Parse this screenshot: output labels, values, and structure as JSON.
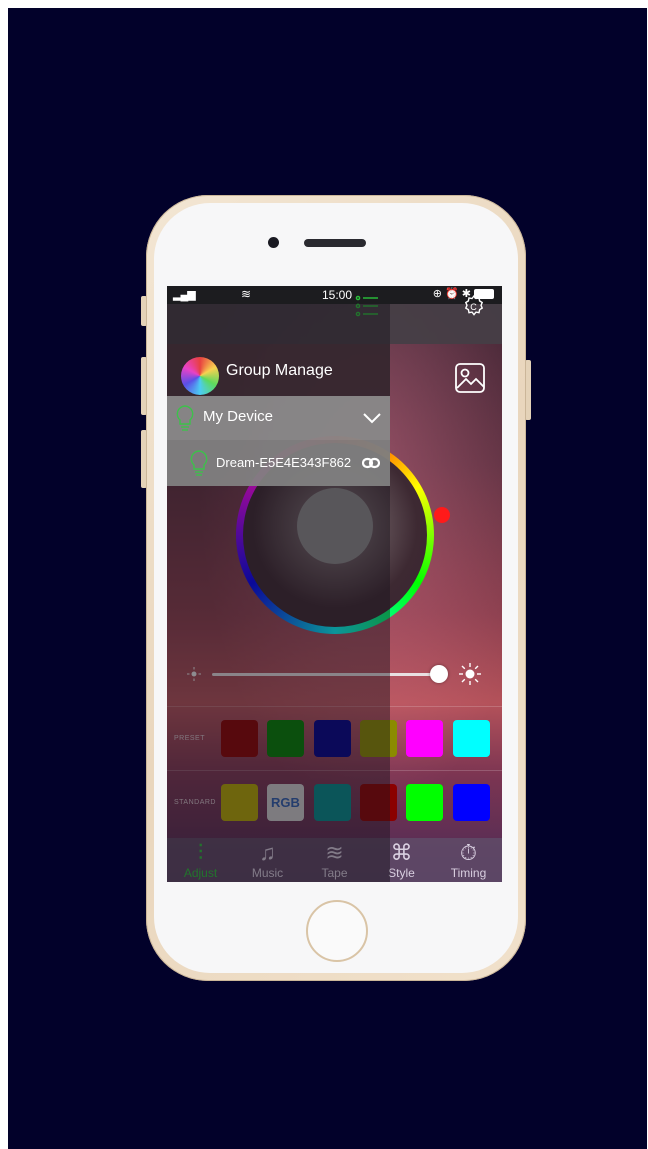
{
  "status_bar": {
    "signal": "▂▄▆",
    "wifi": "≋",
    "time": "15:00",
    "right_icons": "⊕ ⏰ ✱"
  },
  "header": {
    "list_icon": "list-icon",
    "settings_icon": "gear-icon",
    "gallery_icon": "image-icon"
  },
  "drawer": {
    "group_label": "Group Manage",
    "device_section_label": "My Device",
    "device_name": "Dream-E5E4E343F862"
  },
  "brightness": {
    "level": 0.95
  },
  "colors": {
    "wheel_knob": "#ff1a1a",
    "active_tab": "#2ac23a"
  },
  "preset": {
    "label": "PRESET",
    "swatches": [
      "#8b0000",
      "#008000",
      "#00008b",
      "#8b8b00",
      "#ff00ff",
      "#00ffff"
    ]
  },
  "standard": {
    "label": "STANDARD",
    "rgb_label": "RGB",
    "swatches": [
      "#b5a800",
      "#d0d0d0",
      "#008b8b",
      "#8b0000",
      "#00ff00",
      "#0000ff"
    ]
  },
  "tabs": [
    {
      "label": "Adjust",
      "icon": "sliders-icon",
      "glyph": "⫶"
    },
    {
      "label": "Music",
      "icon": "music-note-icon",
      "glyph": "♫"
    },
    {
      "label": "Tape",
      "icon": "waves-icon",
      "glyph": "≋"
    },
    {
      "label": "Style",
      "icon": "command-icon",
      "glyph": "⌘"
    },
    {
      "label": "Timing",
      "icon": "stopwatch-icon",
      "glyph": "⏱"
    }
  ]
}
